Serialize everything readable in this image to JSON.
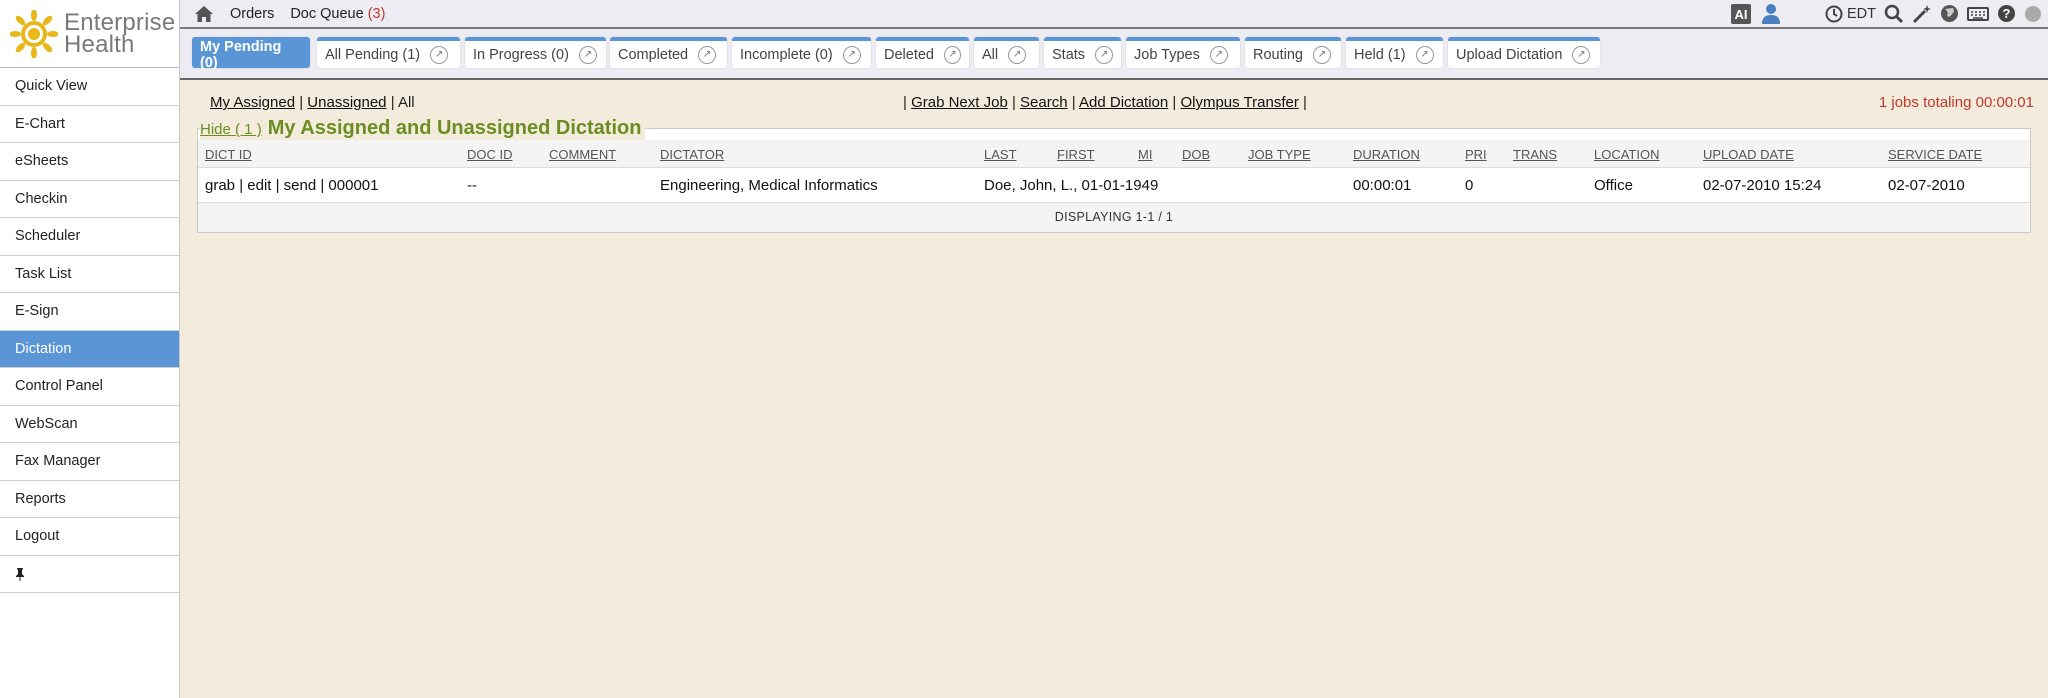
{
  "brand": {
    "line1": "Enterprise",
    "line2": "Health"
  },
  "sidebar": {
    "items": [
      {
        "label": "Quick View",
        "active": false
      },
      {
        "label": "E-Chart",
        "active": false
      },
      {
        "label": "eSheets",
        "active": false
      },
      {
        "label": "Checkin",
        "active": false
      },
      {
        "label": "Scheduler",
        "active": false
      },
      {
        "label": "Task List",
        "active": false
      },
      {
        "label": "E-Sign",
        "active": false
      },
      {
        "label": "Dictation",
        "active": true
      },
      {
        "label": "Control Panel",
        "active": false
      },
      {
        "label": "WebScan",
        "active": false
      },
      {
        "label": "Fax Manager",
        "active": false
      },
      {
        "label": "Reports",
        "active": false
      },
      {
        "label": "Logout",
        "active": false
      }
    ]
  },
  "topbar": {
    "orders": "Orders",
    "doc_queue": "Doc Queue",
    "doc_queue_count": "(3)",
    "ai": "AI",
    "timezone": "EDT"
  },
  "tabs": [
    {
      "label": "My Pending (0)"
    },
    {
      "label": "All Pending (1)"
    },
    {
      "label": "In Progress (0)"
    },
    {
      "label": "Completed"
    },
    {
      "label": "Incomplete (0)"
    },
    {
      "label": "Deleted"
    },
    {
      "label": "All"
    },
    {
      "label": "Stats"
    },
    {
      "label": "Job Types"
    },
    {
      "label": "Routing"
    },
    {
      "label": "Held (1)"
    },
    {
      "label": "Upload Dictation"
    }
  ],
  "filters": {
    "my_assigned": "My Assigned",
    "unassigned": "Unassigned",
    "all": "All",
    "sep": "|"
  },
  "actions": {
    "grab_next": "Grab Next Job",
    "search": "Search",
    "add_dictation": "Add Dictation",
    "olympus": "Olympus Transfer",
    "sep": "|"
  },
  "totals": "1 jobs totaling 00:00:01",
  "panel": {
    "hide": "Hide ( 1 )",
    "title": "My Assigned and Unassigned Dictation"
  },
  "grid": {
    "columns": [
      "DICT ID",
      "DOC ID",
      "COMMENT",
      "DICTATOR",
      "LAST",
      "FIRST",
      "MI",
      "DOB",
      "JOB TYPE",
      "DURATION",
      "PRI",
      "TRANS",
      "LOCATION",
      "UPLOAD DATE",
      "SERVICE DATE"
    ],
    "rows": [
      {
        "dict_id": "grab | edit | send | 000001",
        "doc_id": "--",
        "comment": "",
        "dictator": "Engineering, Medical Informatics",
        "patient": "Doe, John, L., 01-01-1949",
        "job_type": "",
        "duration": "00:00:01",
        "pri": "0",
        "trans": "",
        "location": "Office",
        "upload_date": "02-07-2010 15:24",
        "service_date": "02-07-2010"
      }
    ],
    "footer": "DISPLAYING 1-1 / 1"
  },
  "colors": {
    "accent": "#5a96d6",
    "title_green": "#6b8e23",
    "alert_red": "#c0392b",
    "background": "#f3ecdd"
  },
  "icons": [
    "home-icon",
    "user-icon",
    "clock-icon",
    "search-icon",
    "magic-wand-icon",
    "globe-icon",
    "keyboard-icon",
    "help-icon",
    "status-dot-icon",
    "popout-icon",
    "pin-icon",
    "sun-logo-icon"
  ]
}
